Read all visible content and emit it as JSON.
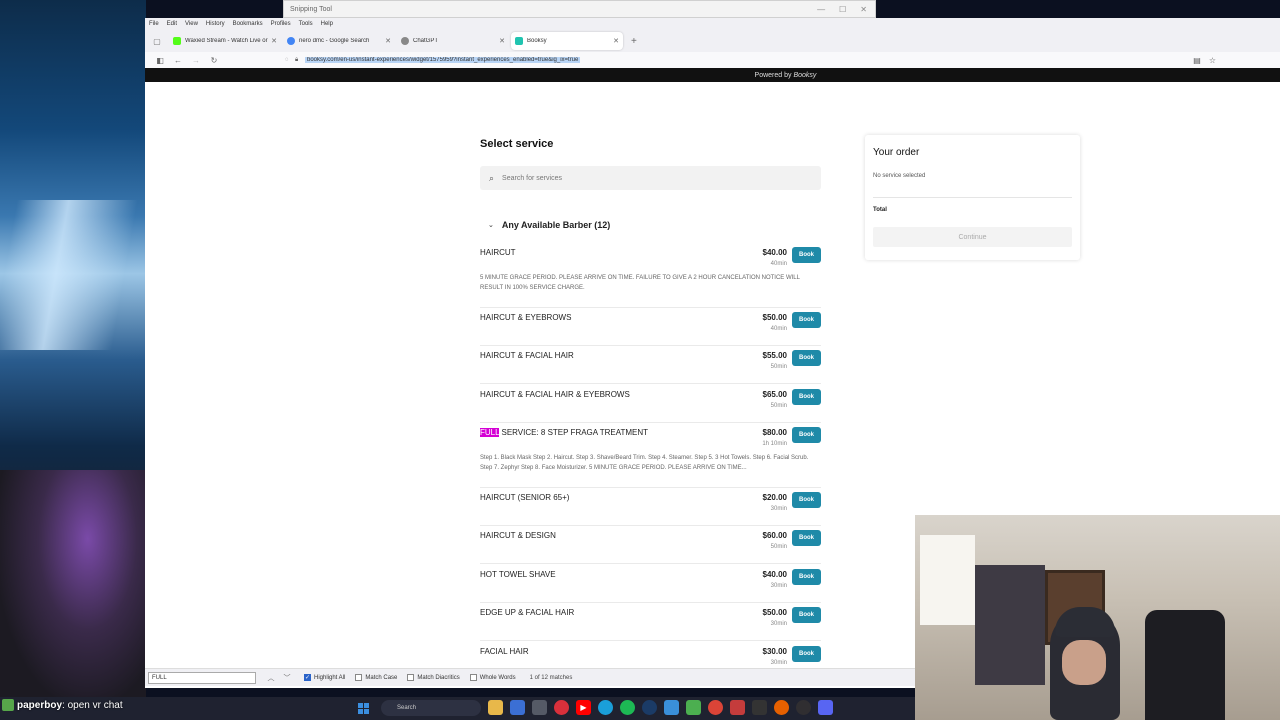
{
  "snipping_tool": {
    "title": "Snipping Tool",
    "min": "—",
    "max": "☐",
    "close": "✕"
  },
  "menubar": [
    "File",
    "Edit",
    "View",
    "History",
    "Bookmarks",
    "Profiles",
    "Tools",
    "Help"
  ],
  "tabs": [
    {
      "title": "Waxied Stream - Watch Live or",
      "color": "#53fc18",
      "active": false
    },
    {
      "title": "nero dmc - Google Search",
      "color": "#4285f4",
      "active": false
    },
    {
      "title": "ChatGPT",
      "color": "#888888",
      "active": false
    },
    {
      "title": "Booksy",
      "color": "#20c4b0",
      "active": true
    }
  ],
  "url": "booksy.com/en-us/instant-experiences/widget/1575959?instant_experiences_enabled=true&ig_ix=true",
  "powered_by": {
    "prefix": "Powered by ",
    "brand": "Booksy"
  },
  "page": {
    "title": "Select service",
    "search_placeholder": "Search for services",
    "group": "Any Available Barber (12)",
    "book_label": "Book"
  },
  "services": [
    {
      "name": "HAIRCUT",
      "price": "$40.00",
      "duration": "40min",
      "desc": "5 MINUTE GRACE PERIOD. PLEASE ARRIVE ON TIME. FAILURE TO GIVE A 2 HOUR CANCELATION NOTICE WILL RESULT IN 100% SERVICE CHARGE."
    },
    {
      "name": "HAIRCUT & EYEBROWS",
      "price": "$50.00",
      "duration": "40min",
      "desc": ""
    },
    {
      "name": "HAIRCUT & FACIAL HAIR",
      "price": "$55.00",
      "duration": "50min",
      "desc": ""
    },
    {
      "name": "HAIRCUT & FACIAL HAIR & EYEBROWS",
      "price": "$65.00",
      "duration": "50min",
      "desc": ""
    },
    {
      "name_highlight": "FULL",
      "name_rest": " SERVICE: 8 STEP FRAGA TREATMENT",
      "price": "$80.00",
      "duration": "1h 10min",
      "desc": "Step 1. Black Mask Step 2. Haircut. Step 3. Shave/Beard Trim. Step 4. Steamer. Step 5. 3 Hot Towels. Step 6. Facial Scrub. Step 7. Zephyr Step 8. Face Moisturizer. 5 MINUTE GRACE PERIOD. PLEASE ARRIVE ON TIME..."
    },
    {
      "name": "HAIRCUT (SENIOR 65+)",
      "price": "$20.00",
      "duration": "30min",
      "desc": ""
    },
    {
      "name": "HAIRCUT & DESIGN",
      "price": "$60.00",
      "duration": "50min",
      "desc": ""
    },
    {
      "name": "HOT TOWEL SHAVE",
      "price": "$40.00",
      "duration": "30min",
      "desc": ""
    },
    {
      "name": "EDGE UP & FACIAL HAIR",
      "price": "$50.00",
      "duration": "30min",
      "desc": ""
    },
    {
      "name": "FACIAL HAIR",
      "price": "$30.00",
      "duration": "30min",
      "desc": ""
    }
  ],
  "order": {
    "title": "Your order",
    "empty": "No service selected",
    "total": "Total",
    "continue": "Continue"
  },
  "findbar": {
    "query": "FULL",
    "highlight_all": "Highlight All",
    "match_case": "Match Case",
    "match_diacritics": "Match Diacritics",
    "whole_words": "Whole Words",
    "matches": "1 of 12 matches"
  },
  "chat_overlay": {
    "user": "paperboy",
    "message": ": open vr chat"
  },
  "taskbar": {
    "search_placeholder": "Search",
    "apps": [
      {
        "name": "file-explorer",
        "color": "#e8b84a"
      },
      {
        "name": "store",
        "color": "#3b6fd4"
      },
      {
        "name": "calculator",
        "color": "#555a66"
      },
      {
        "name": "opera",
        "color": "#d9303b"
      },
      {
        "name": "youtube",
        "color": "#ff0000"
      },
      {
        "name": "edge",
        "color": "#1a9fd9"
      },
      {
        "name": "spotify",
        "color": "#1db954"
      },
      {
        "name": "steam",
        "color": "#1b3b66"
      },
      {
        "name": "notepad",
        "color": "#3a8fd9"
      },
      {
        "name": "vpn",
        "color": "#4caf50"
      },
      {
        "name": "chrome",
        "color": "#db4437"
      },
      {
        "name": "mail",
        "color": "#c43c3c"
      },
      {
        "name": "terminal",
        "color": "#333333"
      },
      {
        "name": "firefox",
        "color": "#e66000"
      },
      {
        "name": "obs",
        "color": "#302e31"
      },
      {
        "name": "discord",
        "color": "#5865f2"
      }
    ]
  }
}
